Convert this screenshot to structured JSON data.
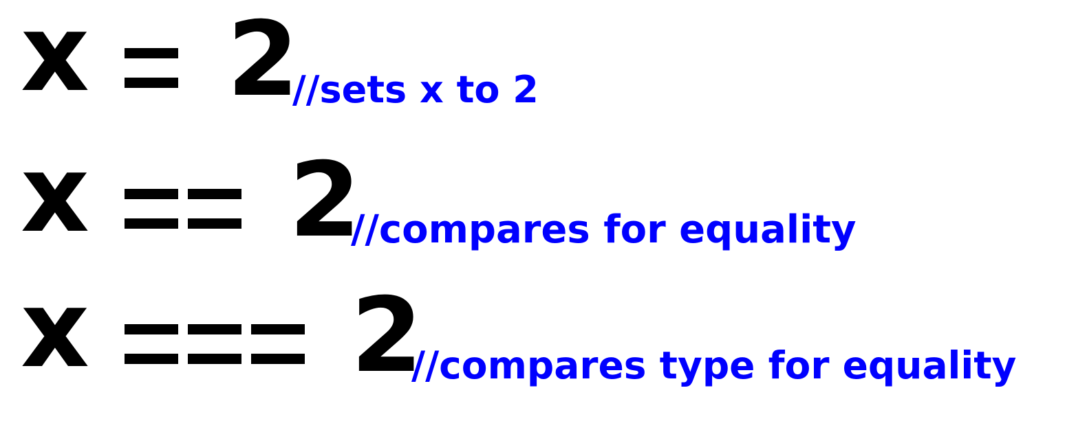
{
  "lines": [
    {
      "variable": "x",
      "operator": "=",
      "value": "2",
      "comment": "//sets x to 2"
    },
    {
      "variable": "x",
      "operator": "==",
      "value": "2",
      "comment": "//compares for equality"
    },
    {
      "variable": "x",
      "operator": "===",
      "value": "2",
      "comment": "//compares type for equality"
    }
  ],
  "colors": {
    "code": "#000000",
    "comment": "#0000ff",
    "background": "#ffffff"
  }
}
